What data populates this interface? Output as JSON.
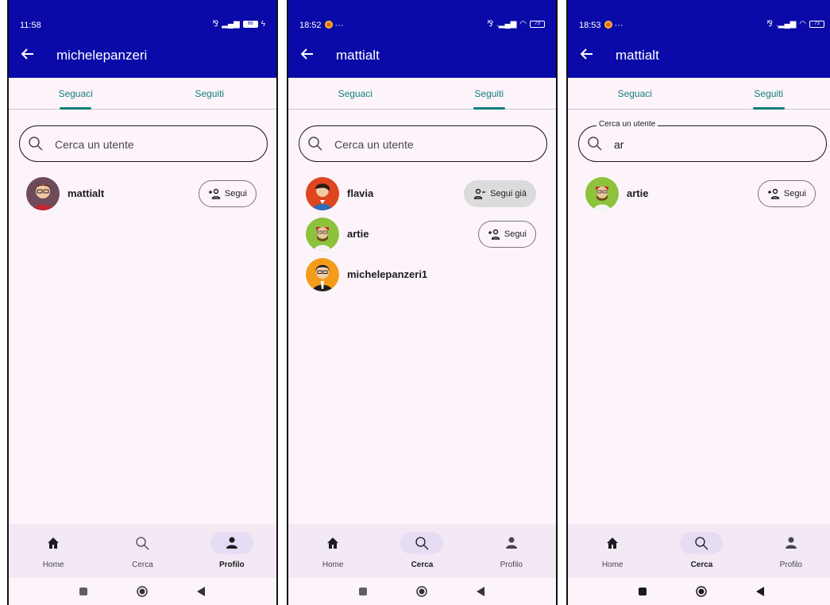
{
  "screens": [
    {
      "status": {
        "time": "11:58",
        "right": "✕  ▍▍▏",
        "battery": "66",
        "app_dot": false
      },
      "title": "michelepanzeri",
      "tabs": [
        {
          "label": "Seguaci",
          "active": true
        },
        {
          "label": "Seguiti",
          "active": false
        }
      ],
      "search": {
        "placeholder": "Cerca un utente",
        "value": "",
        "label": ""
      },
      "users": [
        {
          "name": "mattialt",
          "button": "Segui",
          "following": false
        }
      ],
      "nav": [
        {
          "label": "Home",
          "icon": "home-icon",
          "active": false
        },
        {
          "label": "Cerca",
          "icon": "search-icon",
          "active": false
        },
        {
          "label": "Profilo",
          "icon": "person-icon",
          "active": true
        }
      ]
    },
    {
      "status": {
        "time": "18:52",
        "right": "✕ .▍▍ ☁",
        "battery": "73",
        "app_dot": true
      },
      "title": "mattialt",
      "tabs": [
        {
          "label": "Seguaci",
          "active": false
        },
        {
          "label": "Seguiti",
          "active": true
        }
      ],
      "search": {
        "placeholder": "Cerca un utente",
        "value": "",
        "label": ""
      },
      "users": [
        {
          "name": "flavia",
          "button": "Segui già",
          "following": true
        },
        {
          "name": "artie",
          "button": "Segui",
          "following": false
        },
        {
          "name": "michelepanzeri1",
          "button": "",
          "following": false
        }
      ],
      "nav": [
        {
          "label": "Home",
          "icon": "home-icon",
          "active": false
        },
        {
          "label": "Cerca",
          "icon": "search-icon",
          "active": true
        },
        {
          "label": "Profilo",
          "icon": "person-icon",
          "active": false
        }
      ]
    },
    {
      "status": {
        "time": "18:53",
        "right": "✕ .▍▍ ☁",
        "battery": "73",
        "app_dot": true
      },
      "title": "mattialt",
      "tabs": [
        {
          "label": "Seguaci",
          "active": false
        },
        {
          "label": "Seguiti",
          "active": true
        }
      ],
      "search": {
        "placeholder": "",
        "value": "ar",
        "label": "Cerca un utente"
      },
      "users": [
        {
          "name": "artie",
          "button": "Segui",
          "following": false
        }
      ],
      "nav": [
        {
          "label": "Home",
          "icon": "home-icon",
          "active": false
        },
        {
          "label": "Cerca",
          "icon": "search-icon",
          "active": true
        },
        {
          "label": "Profilo",
          "icon": "person-icon",
          "active": false
        }
      ]
    }
  ],
  "colors": {
    "appbar": "#0a0aa8",
    "accent": "#13807a",
    "surface": "#fdf4fb",
    "nav": "#f2e9f4",
    "nav_pill": "#e6dcf4"
  }
}
